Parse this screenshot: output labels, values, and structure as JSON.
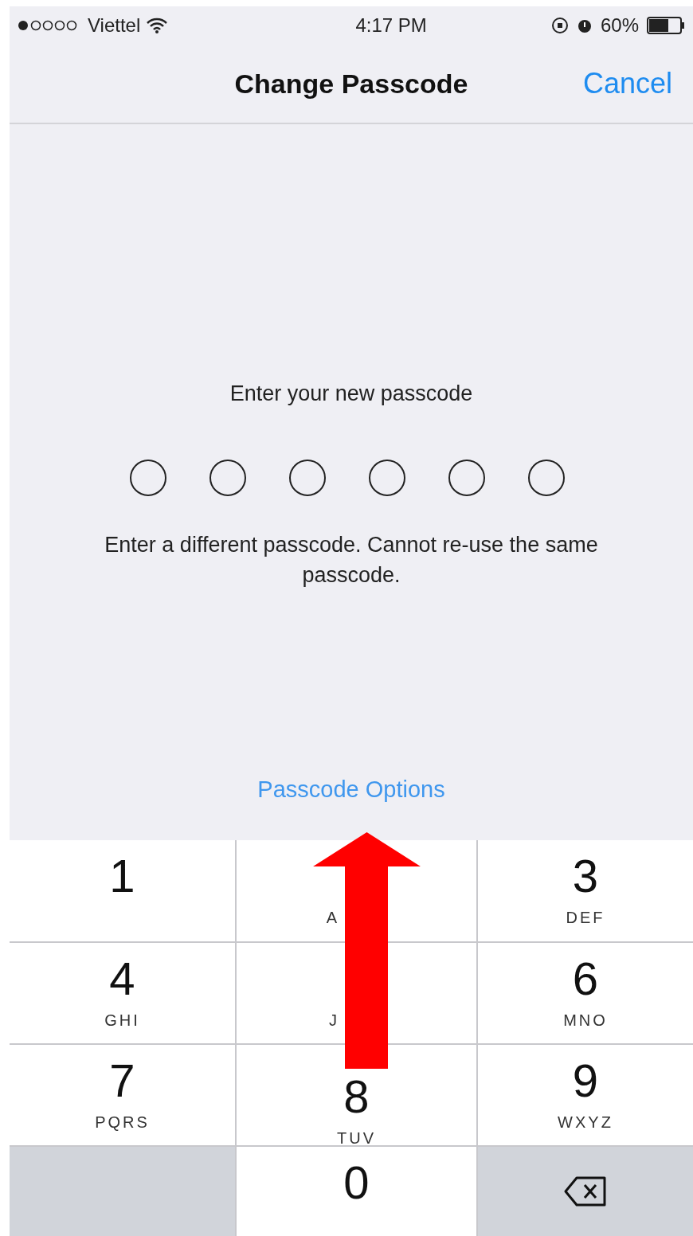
{
  "status_bar": {
    "carrier": "Viettel",
    "time": "4:17 PM",
    "battery": "60%"
  },
  "nav": {
    "title": "Change Passcode",
    "cancel": "Cancel"
  },
  "prompt": "Enter your new passcode",
  "dots": [
    {
      "filled": false
    },
    {
      "filled": false
    },
    {
      "filled": false
    },
    {
      "filled": false
    },
    {
      "filled": false
    },
    {
      "filled": false
    }
  ],
  "message": "Enter a different passcode. Cannot re-use the same passcode.",
  "options_link": "Passcode Options",
  "keys": [
    {
      "kind": "digit",
      "digit": "1"
    },
    {
      "kind": "digit",
      "letters": "A"
    },
    {
      "kind": "digit",
      "digit": "3",
      "letters": "DEF"
    },
    {
      "kind": "digit",
      "digit": "4",
      "letters": "GHI"
    },
    {
      "kind": "digit",
      "letters": "J"
    },
    {
      "kind": "digit",
      "digit": "6",
      "letters": "MNO"
    },
    {
      "kind": "digit",
      "digit": "7",
      "letters": "PQRS"
    },
    {
      "kind": "digit",
      "digit": "8",
      "letters": "TUV"
    },
    {
      "kind": "digit",
      "digit": "9",
      "letters": "WXYZ"
    },
    {
      "kind": "blank"
    },
    {
      "kind": "digit",
      "digit": "0"
    },
    {
      "kind": "delete"
    }
  ]
}
